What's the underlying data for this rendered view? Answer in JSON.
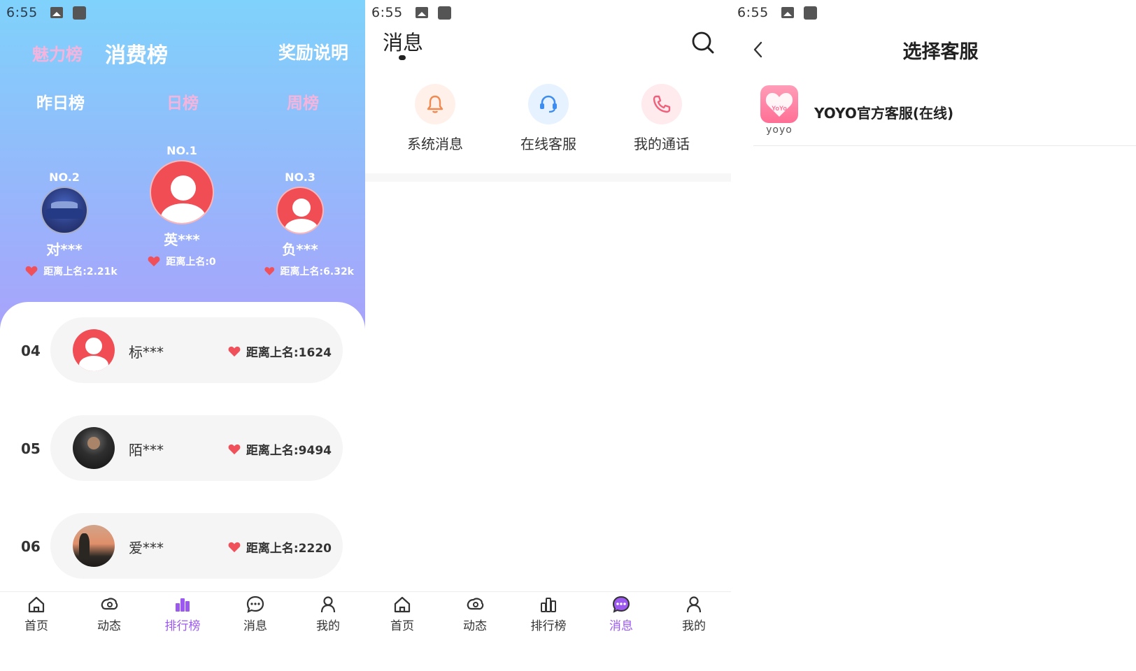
{
  "status_bar": {
    "time": "6:55"
  },
  "ranking": {
    "top_tabs": {
      "charm": "魅力榜",
      "spending": "消费榜",
      "rules": "奖励说明"
    },
    "sub_tabs": {
      "yesterday": "昨日榜",
      "daily": "日榜",
      "weekly": "周榜"
    },
    "podium": [
      {
        "rank": "NO.2",
        "name": "对***",
        "gap": "距离上名:2.21k"
      },
      {
        "rank": "NO.1",
        "name": "英***",
        "gap": "距离上名:0"
      },
      {
        "rank": "NO.3",
        "name": "负***",
        "gap": "距离上名:6.32k"
      }
    ],
    "list": [
      {
        "num": "04",
        "name": "标***",
        "gap": "距离上名:1624"
      },
      {
        "num": "05",
        "name": "陌***",
        "gap": "距离上名:9494"
      },
      {
        "num": "06",
        "name": "爱***",
        "gap": "距离上名:2220"
      }
    ]
  },
  "bottom_nav": {
    "home": "首页",
    "moments": "动态",
    "ranking": "排行榜",
    "messages": "消息",
    "mine": "我的"
  },
  "messages": {
    "title": "消息",
    "shortcuts": {
      "system": "系统消息",
      "online_service": "在线客服",
      "my_calls": "我的通话"
    }
  },
  "customer_service": {
    "title": "选择客服",
    "item": {
      "name": "YOYO官方客服(在线)",
      "logo_text": "yoyo",
      "logo_badge": "YoYo"
    }
  },
  "colors": {
    "accent": "#9b59f0",
    "heart": "#f0505a",
    "avatar_default": "#f04d55",
    "tab_dim": "#f4b4dd"
  }
}
